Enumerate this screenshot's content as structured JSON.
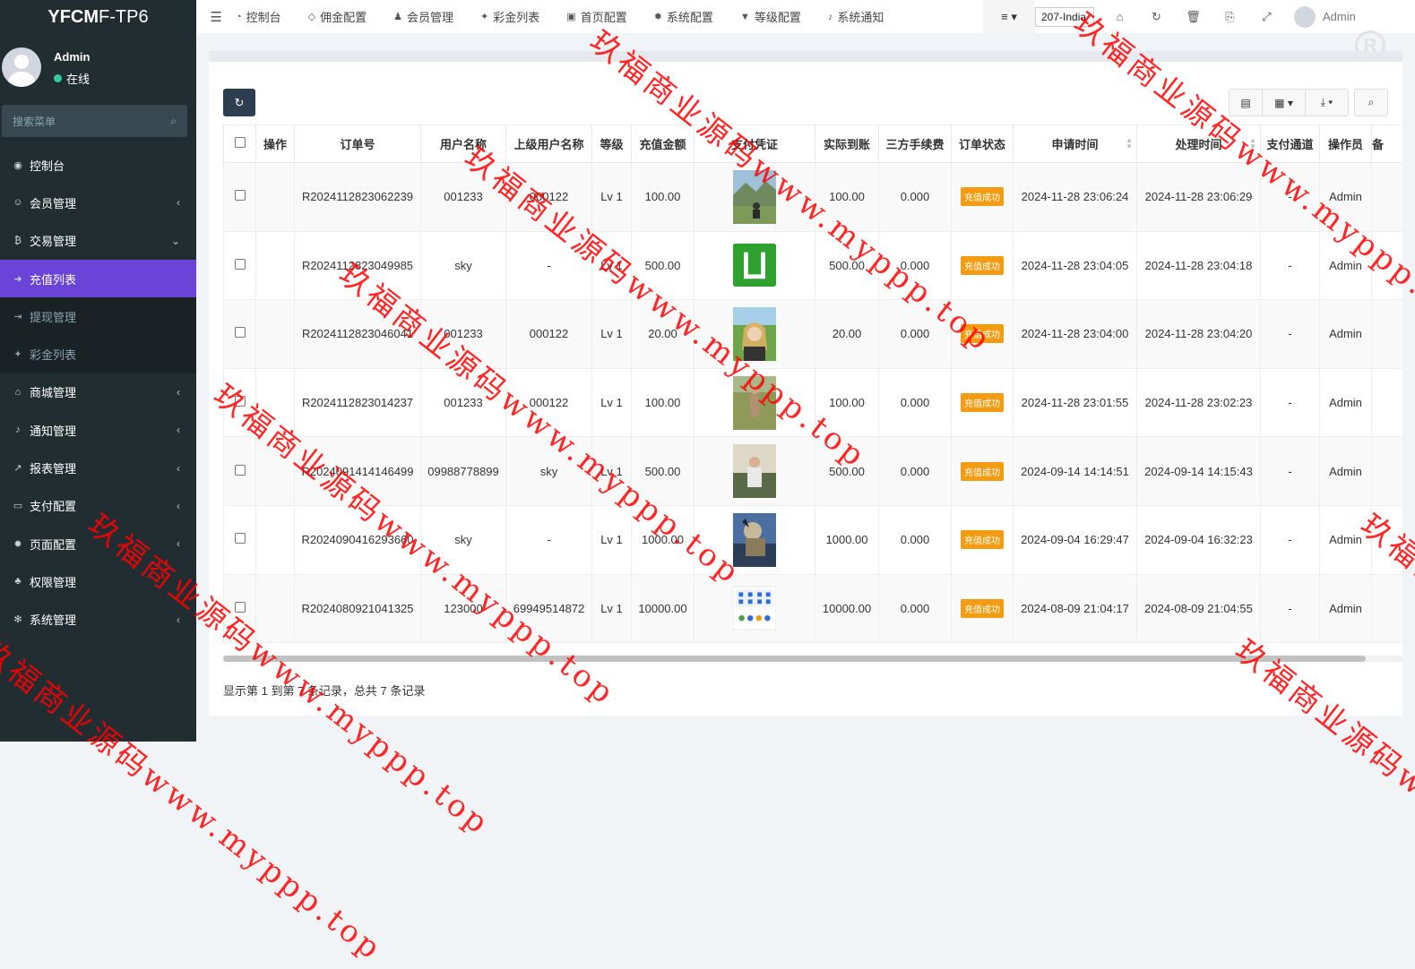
{
  "app": {
    "logo_bold": "YFCM",
    "logo_rest": "F-TP6"
  },
  "user": {
    "name": "Admin",
    "status": "在线"
  },
  "sidebar": {
    "search_placeholder": "搜索菜单",
    "items": [
      {
        "label": "控制台",
        "icon": "dashboard-icon",
        "glyph": "◉",
        "arrow": ""
      },
      {
        "label": "会员管理",
        "icon": "user-circle-icon",
        "glyph": "☺",
        "arrow": "‹"
      },
      {
        "label": "交易管理",
        "icon": "bitcoin-icon",
        "glyph": "₿",
        "arrow": "⌄"
      },
      {
        "label": "充值列表",
        "icon": "sign-in-icon",
        "glyph": "➜",
        "arrow": ""
      },
      {
        "label": "提现管理",
        "icon": "sign-out-icon",
        "glyph": "⇥",
        "arrow": ""
      },
      {
        "label": "彩金列表",
        "icon": "gift-icon",
        "glyph": "✦",
        "arrow": ""
      },
      {
        "label": "商城管理",
        "icon": "home-icon",
        "glyph": "⌂",
        "arrow": "‹"
      },
      {
        "label": "通知管理",
        "icon": "bell-icon",
        "glyph": "♪",
        "arrow": "‹"
      },
      {
        "label": "报表管理",
        "icon": "line-chart-icon",
        "glyph": "↗",
        "arrow": "‹"
      },
      {
        "label": "支付配置",
        "icon": "credit-card-icon",
        "glyph": "▭",
        "arrow": "‹"
      },
      {
        "label": "页面配置",
        "icon": "gear-icon",
        "glyph": "✹",
        "arrow": "‹"
      },
      {
        "label": "权限管理",
        "icon": "users-icon",
        "glyph": "♣",
        "arrow": ""
      },
      {
        "label": "系统管理",
        "icon": "cogs-icon",
        "glyph": "✻",
        "arrow": "‹"
      }
    ]
  },
  "topnav": {
    "items": [
      {
        "label": "控制台",
        "glyph": "◔"
      },
      {
        "label": "佣金配置",
        "glyph": "◇"
      },
      {
        "label": "会员管理",
        "glyph": "♟"
      },
      {
        "label": "彩金列表",
        "glyph": "✦"
      },
      {
        "label": "首页配置",
        "glyph": "▣"
      },
      {
        "label": "系统配置",
        "glyph": "✹"
      },
      {
        "label": "等级配置",
        "glyph": "▼"
      },
      {
        "label": "系统通知",
        "glyph": "♪"
      }
    ],
    "lang_select": "207-India",
    "user_name": "Admin"
  },
  "table": {
    "headers": [
      "操作",
      "订单号",
      "用户名称",
      "上级用户名称",
      "等级",
      "充值金额",
      "支付凭证",
      "实际到账",
      "三方手续费",
      "订单状态",
      "申请时间",
      "处理时间",
      "支付通道",
      "操作员",
      "备"
    ],
    "rows": [
      {
        "order": "R2024112823062239",
        "user": "001233",
        "parent": "000122",
        "level": "Lv 1",
        "amount": "100.00",
        "actual": "100.00",
        "fee": "0.000",
        "status": "充值成功",
        "apply": "2024-11-28 23:06:24",
        "process": "2024-11-28 23:06:29",
        "channel": "-",
        "operator": "Admin",
        "img": "landscape"
      },
      {
        "order": "R2024112823049985",
        "user": "sky",
        "parent": "-",
        "level": "Lv 1",
        "amount": "500.00",
        "actual": "500.00",
        "fee": "0.000",
        "status": "充值成功",
        "apply": "2024-11-28 23:04:05",
        "process": "2024-11-28 23:04:18",
        "channel": "-",
        "operator": "Admin",
        "img": "green-logo"
      },
      {
        "order": "R2024112823046041",
        "user": "001233",
        "parent": "000122",
        "level": "Lv 1",
        "amount": "20.00",
        "actual": "20.00",
        "fee": "0.000",
        "status": "充值成功",
        "apply": "2024-11-28 23:04:00",
        "process": "2024-11-28 23:04:20",
        "channel": "-",
        "operator": "Admin",
        "img": "portrait"
      },
      {
        "order": "R2024112823014237",
        "user": "001233",
        "parent": "000122",
        "level": "Lv 1",
        "amount": "100.00",
        "actual": "100.00",
        "fee": "0.000",
        "status": "充值成功",
        "apply": "2024-11-28 23:01:55",
        "process": "2024-11-28 23:02:23",
        "channel": "-",
        "operator": "Admin",
        "img": "field"
      },
      {
        "order": "R2024091414146499",
        "user": "09988778899",
        "parent": "sky",
        "level": "Lv 1",
        "amount": "500.00",
        "actual": "500.00",
        "fee": "0.000",
        "status": "充值成功",
        "apply": "2024-09-14 14:14:51",
        "process": "2024-09-14 14:15:43",
        "channel": "-",
        "operator": "Admin",
        "img": "person-sofa"
      },
      {
        "order": "R2024090416293660",
        "user": "sky",
        "parent": "-",
        "level": "Lv 1",
        "amount": "1000.00",
        "actual": "1000.00",
        "fee": "0.000",
        "status": "充值成功",
        "apply": "2024-09-04 16:29:47",
        "process": "2024-09-04 16:32:23",
        "channel": "-",
        "operator": "Admin",
        "img": "dog"
      },
      {
        "order": "R2024080921041325",
        "user": "123000",
        "parent": "69949514872",
        "level": "Lv 1",
        "amount": "10000.00",
        "actual": "10000.00",
        "fee": "0.000",
        "status": "充值成功",
        "apply": "2024-08-09 21:04:17",
        "process": "2024-08-09 21:04:55",
        "channel": "-",
        "operator": "Admin",
        "img": "app-screen"
      }
    ]
  },
  "pagination": {
    "info": "显示第 1 到第 7 条记录，总共 7 条记录"
  },
  "watermark": {
    "text": "玖福商业源码www.myppp.top",
    "color": "#ff0000"
  },
  "colors": {
    "accent": "#6a44d6",
    "sidebar": "#222d32",
    "status_badge": "#f39c12"
  }
}
